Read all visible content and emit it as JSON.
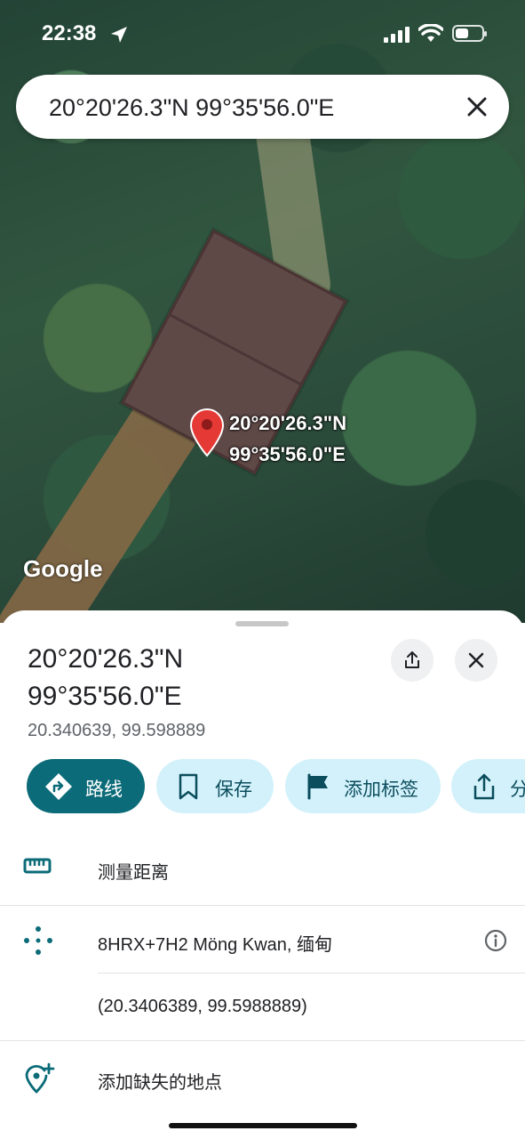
{
  "status_bar": {
    "time": "22:38"
  },
  "search": {
    "query": "20°20'26.3\"N 99°35'56.0\"E"
  },
  "map": {
    "pin_label_line1": "20°20'26.3\"N",
    "pin_label_line2": "99°35'56.0\"E",
    "attribution": "Google",
    "pin_color": "#e53935"
  },
  "sheet": {
    "title_line1": "20°20'26.3\"N",
    "title_line2": "99°35'56.0\"E",
    "decimal_coords": "20.340639, 99.598889",
    "actions": [
      {
        "label": "路线",
        "icon": "directions-icon"
      },
      {
        "label": "保存",
        "icon": "bookmark-icon"
      },
      {
        "label": "添加标签",
        "icon": "flag-icon"
      },
      {
        "label": "分",
        "icon": "share-icon"
      }
    ],
    "rows": {
      "measure": {
        "label": "测量距离",
        "icon": "ruler-icon"
      },
      "plus_code": {
        "label": "8HRX+7H2 Möng Kwan, 缅甸",
        "icon": "plus-code-icon"
      },
      "coords_precise": {
        "label": "(20.3406389, 99.5988889)"
      },
      "add_place": {
        "label": "添加缺失的地点",
        "icon": "add-place-icon"
      }
    }
  },
  "colors": {
    "accent": "#0b6b78",
    "chip_bg": "#d3f1fb"
  }
}
